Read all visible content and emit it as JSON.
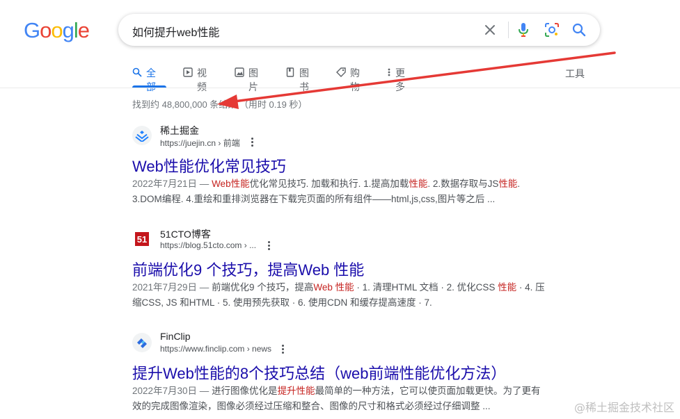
{
  "logo": {
    "letters": [
      "G",
      "o",
      "o",
      "g",
      "l",
      "e"
    ],
    "colors": [
      "#4285f4",
      "#ea4335",
      "#fbbc05",
      "#4285f4",
      "#34a853",
      "#ea4335"
    ]
  },
  "search": {
    "query": "如何提升web性能",
    "icons": [
      "clear-icon",
      "microphone-icon",
      "lens-icon",
      "search-icon"
    ]
  },
  "tabs": [
    {
      "label": "全部",
      "icon": "search-icon",
      "active": true
    },
    {
      "label": "视频",
      "icon": "play-icon"
    },
    {
      "label": "图片",
      "icon": "image-icon"
    },
    {
      "label": "图书",
      "icon": "book-icon"
    },
    {
      "label": "购物",
      "icon": "tag-icon"
    },
    {
      "label": "更多",
      "icon": "more-vert-icon"
    }
  ],
  "tools_label": "工具",
  "stats": "找到约 48,800,000 条结果 （用时 0.19 秒）",
  "results": [
    {
      "site": "稀土掘金",
      "url": "https://juejin.cn › 前端",
      "title": "Web性能优化常见技巧",
      "snippet_date": "2022年7月21日 — ",
      "snippet_parts": [
        {
          "t": "Web性能",
          "hl": true
        },
        {
          "t": "优化常见技巧. 加载和执行. 1.提高加载"
        },
        {
          "t": "性能",
          "hl": true
        },
        {
          "t": ". 2.数据存取与JS"
        },
        {
          "t": "性能",
          "hl": true
        },
        {
          "t": ". 3.DOM编程. 4.重绘和重排浏览器在下载完页面的所有组件——html,js,css,图片等之后 ..."
        }
      ]
    },
    {
      "site": "51CTO博客",
      "url": "https://blog.51cto.com › ...",
      "title": "前端优化9 个技巧，提高Web 性能",
      "snippet_date": "2021年7月29日 — ",
      "snippet_parts": [
        {
          "t": "前端优化9 个技巧，提高"
        },
        {
          "t": "Web 性能",
          "hl": true
        },
        {
          "t": " · 1. 清理HTML 文档 · 2. 优化CSS "
        },
        {
          "t": "性能",
          "hl": true
        },
        {
          "t": " · 4. 压缩CSS, JS 和HTML · 5. 使用预先获取 · 6. 使用CDN 和缓存提高速度 · 7."
        }
      ]
    },
    {
      "site": "FinClip",
      "url": "https://www.finclip.com › news",
      "title": "提升Web性能的8个技巧总结（web前端性能优化方法）",
      "snippet_date": "2022年7月30日 — ",
      "snippet_parts": [
        {
          "t": "进行图像优化是"
        },
        {
          "t": "提升性能",
          "hl": true
        },
        {
          "t": "最简单的一种方法，它可以使页面加载更快。为了更有效的完成图像渲染，图像必须经过压缩和整合、图像的尺寸和格式必须经过仔细调整 ..."
        }
      ]
    }
  ],
  "watermark": "@稀土掘金技术社区",
  "colors": {
    "link": "#1a0dab",
    "accent": "#1a73e8",
    "highlight": "#c5221f",
    "arrow": "#e53935"
  }
}
